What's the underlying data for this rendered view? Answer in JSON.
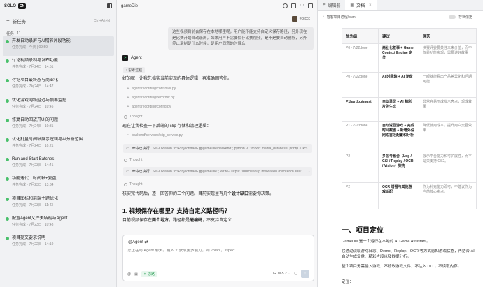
{
  "sidebar": {
    "logo": "SOLO",
    "logo_badge": "CN",
    "new_task": "新任务",
    "new_task_shortcut": "Ctrl+Alt+N",
    "tasks_label": "任务",
    "tasks_count": "11",
    "tasks": [
      {
        "title": "开发自动录屏与AI精彩片段功能",
        "meta": "任务完成 · 今天 | 09:59"
      },
      {
        "title": "讨论视频录制与发布功能",
        "meta": "任务完成 · 7月24日 | 14:51"
      },
      {
        "title": "讨论项目最终态与商业化",
        "meta": "任务完成 · 7月24日 | 14:47"
      },
      {
        "title": "优化游戏网络延迟与帧率监控",
        "meta": "任务完成 · 7月24日 | 10:45"
      },
      {
        "title": "修复自动回放开UI的问题",
        "meta": "任务完成 · 7月24日 | 10:31"
      },
      {
        "title": "优化批量时间轴展示逻辑与AI分析范围",
        "meta": "任务完成 · 7月24日 | 10:21"
      },
      {
        "title": "Run and Start Batches",
        "meta": "任务完成 · 7月23日 | 14:41"
      },
      {
        "title": "功能迭代：时间轴+复盘",
        "meta": "任务完成 · 7月23日 | 13:34"
      },
      {
        "title": "项目图标和前端主题优化",
        "meta": "任务完成 · 7月23日 | 11:43"
      },
      {
        "title": "配置Agent文件关结构与Agent",
        "meta": "任务完成 · 7月23日 | 10:48"
      },
      {
        "title": "项目提交要求说明",
        "meta": "任务完成 · 7月22日 | 14:19"
      }
    ]
  },
  "chat": {
    "title": "gameDie",
    "username": "#ccccc",
    "user_message": "这些视频目前会保存在本地哪里呢，用户能不能支持自定义保存路径，另外现在是比赛开始自动录屏，如果用户不需要保存比赛视频，是不是要自动删除，另外停止录制是什么时候，是用户同意的时候么",
    "agent_name": "Agent",
    "think_tag": "思考过程",
    "intro": "好的呢，让我先搞实当前实现的具体逻辑，再准确回答你。",
    "files": [
      "agent\\recording\\controller.py",
      "agent\\recording\\recorder.py",
      "agent\\recording\\config.py"
    ],
    "thought_label": "Thought",
    "line2": "现在让我检查一下后端的 clip 存储和清理逻辑：",
    "file2": "backend\\services\\clip_service.py",
    "cmd_label": "命令已执行",
    "cmd1": "Set-Location \"d:\\Project\\traeE面\\gameDie\\backend\"; python -c \"import media_database; print(CLIPS...",
    "cmd2": "Set-Location \"d:\\Project\\traeE面\\gameDie\"; Write-Output \"===cleanup invocation (backend) ===\"...",
    "line3_a": "核实完代码后，逐一回答你的三个问题。目前实现里有几个",
    "line3_b": "设计缺口",
    "line3_c": "需要你决策。",
    "heading": "1. 视频保存在哪里？支持自定义路径吗？",
    "line4_a": "目前视频保存在",
    "line4_b": "两个地方",
    "line4_c": "，路径都是",
    "line4_d": "硬编码",
    "line4_e": "，不支持自定义：",
    "input_mention": "@Agent",
    "input_placeholder": "您正在与 Agent 聊天。输入 '/' 获取更多能力，如 '/plan'，'/spec'",
    "tool_pill": "思路",
    "model": "GLM-5.2"
  },
  "doc": {
    "tab1": "编辑器",
    "tab2": "文档",
    "path": "智客项目进程/plan",
    "save_label": "存档依据",
    "table": {
      "headers": [
        "优先级",
        "建议",
        "原因"
      ],
      "rows": [
        [
          "P0 · 7/22done",
          "商业化叙事 + Game Context Engine 定位",
          "决赛评委要关注未来价值，而不仅是功能实现，需要讲好故事"
        ],
        [
          "P0 · 7/22done",
          "AI 时间轴 + AI 复盘",
          "一眼就能看出产品差异化和后期可能"
        ],
        [
          "P1hardbutmust",
          "自动录屏 + AI 精彩片段生成",
          "非常容易形成演示亮点，现成效果"
        ],
        [
          "P1 · 7/23done",
          "自动返回游戏 + 完成时间截图 + 新增外设网络首段配置和分析",
          "降低使用成本，提升用户交互效果"
        ],
        [
          "P2",
          "多信号融合（Log / GSI / Replay / OCR / Vision）架构",
          "展示平台能力和可扩展性，而不是只支持 CS2。"
        ],
        [
          "P2",
          "OCR 增强与其他游戏适配",
          "作为补充能力即可，不建议作为当前核心卖点。"
        ]
      ]
    },
    "h1": "一、项目定位",
    "p1": "GameDie 是一个运行在本地的 AI Game Assistant。",
    "p2": "它通过读取游戏日志、Demo、Replay、OCR 等方式感知游戏状态，再结合 AI 自动生成复盘、精彩片段以及数据分析。",
    "p3": "整个项目无需侵入游戏，不修改游戏文件，不注入 DLL，不读取内存。",
    "p4": "定位："
  }
}
